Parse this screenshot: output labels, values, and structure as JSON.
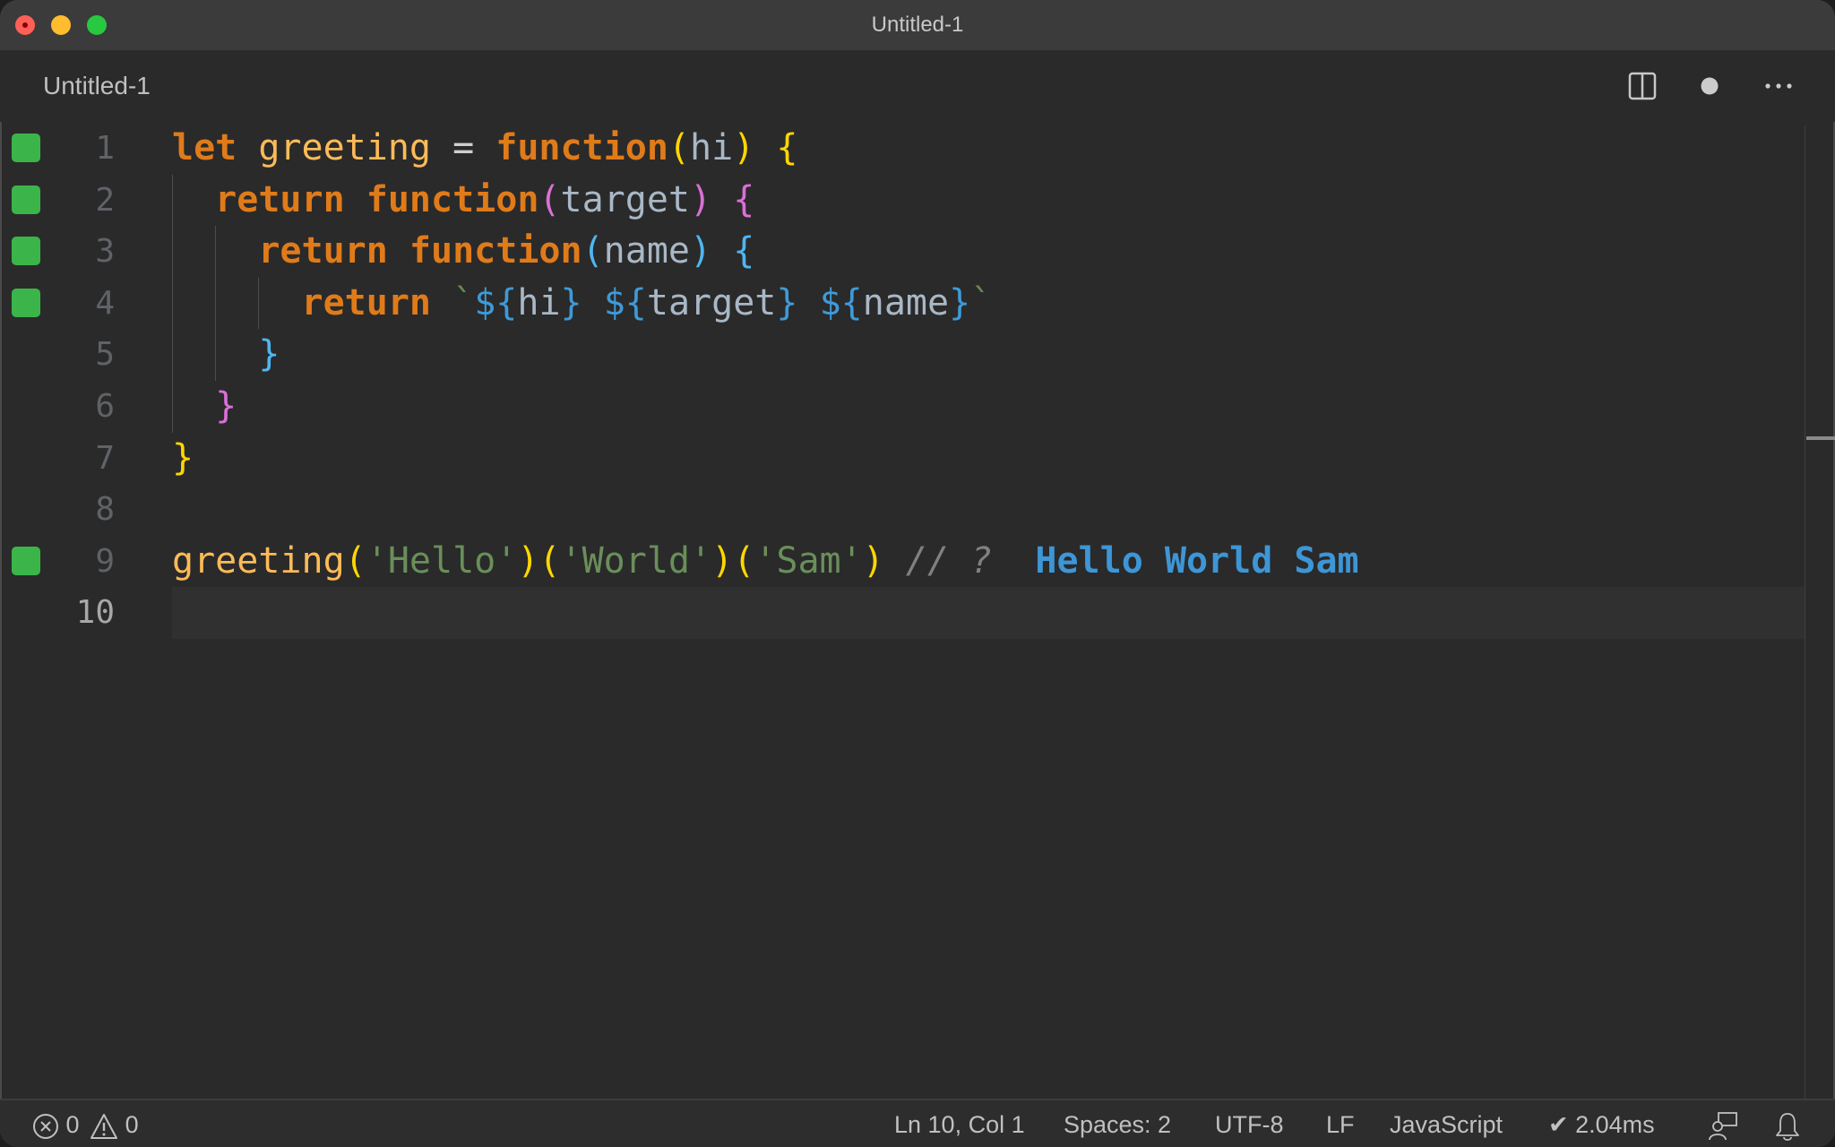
{
  "window": {
    "title": "Untitled-1"
  },
  "tab": {
    "label": "Untitled-1",
    "actions": [
      {
        "name": "split-editor",
        "icon": "split-editor-icon"
      },
      {
        "name": "unsaved-indicator",
        "icon": "dot-icon"
      },
      {
        "name": "more-actions",
        "icon": "ellipsis-icon",
        "glyph": "···"
      }
    ]
  },
  "editor": {
    "language": "JavaScript",
    "lines": [
      {
        "number": "1",
        "marker": true,
        "current": false,
        "tokens": [
          {
            "t": "let",
            "c": "kw"
          },
          {
            "t": " ",
            "c": "op"
          },
          {
            "t": "greeting",
            "c": "fn"
          },
          {
            "t": " = ",
            "c": "op"
          },
          {
            "t": "function",
            "c": "kw"
          },
          {
            "t": "(",
            "c": "p1"
          },
          {
            "t": "hi",
            "c": "var"
          },
          {
            "t": ")",
            "c": "p1"
          },
          {
            "t": " ",
            "c": "op"
          },
          {
            "t": "{",
            "c": "p1"
          }
        ]
      },
      {
        "number": "2",
        "marker": true,
        "current": false,
        "tokens": [
          {
            "t": "  ",
            "c": "op"
          },
          {
            "t": "return",
            "c": "kw"
          },
          {
            "t": " ",
            "c": "op"
          },
          {
            "t": "function",
            "c": "kw"
          },
          {
            "t": "(",
            "c": "p2"
          },
          {
            "t": "target",
            "c": "var"
          },
          {
            "t": ")",
            "c": "p2"
          },
          {
            "t": " ",
            "c": "op"
          },
          {
            "t": "{",
            "c": "p2"
          }
        ]
      },
      {
        "number": "3",
        "marker": true,
        "current": false,
        "tokens": [
          {
            "t": "    ",
            "c": "op"
          },
          {
            "t": "return",
            "c": "kw"
          },
          {
            "t": " ",
            "c": "op"
          },
          {
            "t": "function",
            "c": "kw"
          },
          {
            "t": "(",
            "c": "p3"
          },
          {
            "t": "name",
            "c": "var"
          },
          {
            "t": ")",
            "c": "p3"
          },
          {
            "t": " ",
            "c": "op"
          },
          {
            "t": "{",
            "c": "p3"
          }
        ]
      },
      {
        "number": "4",
        "marker": true,
        "current": false,
        "tokens": [
          {
            "t": "      ",
            "c": "op"
          },
          {
            "t": "return",
            "c": "kw"
          },
          {
            "t": " ",
            "c": "op"
          },
          {
            "t": "`",
            "c": "tpl"
          },
          {
            "t": "${",
            "c": "interp"
          },
          {
            "t": "hi",
            "c": "var"
          },
          {
            "t": "}",
            "c": "interp"
          },
          {
            "t": " ",
            "c": "tpl"
          },
          {
            "t": "${",
            "c": "interp"
          },
          {
            "t": "target",
            "c": "var"
          },
          {
            "t": "}",
            "c": "interp"
          },
          {
            "t": " ",
            "c": "tpl"
          },
          {
            "t": "${",
            "c": "interp"
          },
          {
            "t": "name",
            "c": "var"
          },
          {
            "t": "}",
            "c": "interp"
          },
          {
            "t": "`",
            "c": "tpl"
          }
        ]
      },
      {
        "number": "5",
        "marker": false,
        "current": false,
        "tokens": [
          {
            "t": "    ",
            "c": "op"
          },
          {
            "t": "}",
            "c": "p3"
          }
        ]
      },
      {
        "number": "6",
        "marker": false,
        "current": false,
        "tokens": [
          {
            "t": "  ",
            "c": "op"
          },
          {
            "t": "}",
            "c": "p2"
          }
        ]
      },
      {
        "number": "7",
        "marker": false,
        "current": false,
        "tokens": [
          {
            "t": "}",
            "c": "p1"
          }
        ]
      },
      {
        "number": "8",
        "marker": false,
        "current": false,
        "tokens": []
      },
      {
        "number": "9",
        "marker": true,
        "current": false,
        "tokens": [
          {
            "t": "greeting",
            "c": "fn"
          },
          {
            "t": "(",
            "c": "p1"
          },
          {
            "t": "'Hello'",
            "c": "str"
          },
          {
            "t": ")",
            "c": "p1"
          },
          {
            "t": "(",
            "c": "p1"
          },
          {
            "t": "'World'",
            "c": "str"
          },
          {
            "t": ")",
            "c": "p1"
          },
          {
            "t": "(",
            "c": "p1"
          },
          {
            "t": "'Sam'",
            "c": "str"
          },
          {
            "t": ")",
            "c": "p1"
          },
          {
            "t": " ",
            "c": "op"
          },
          {
            "t": "// ?",
            "c": "cmt"
          },
          {
            "t": "  ",
            "c": "op"
          },
          {
            "t": "Hello World Sam",
            "c": "result"
          }
        ]
      },
      {
        "number": "10",
        "marker": false,
        "current": true,
        "tokens": []
      }
    ],
    "marker_color": "#3bb54a"
  },
  "status": {
    "errors": "0",
    "warnings": "0",
    "cursor": "Ln 10, Col 1",
    "indent": "Spaces: 2",
    "encoding": "UTF-8",
    "eol": "LF",
    "language": "JavaScript",
    "timing": "✔ 2.04ms",
    "feedback_icon": "feedback-icon",
    "notifications_icon": "bell-icon"
  }
}
